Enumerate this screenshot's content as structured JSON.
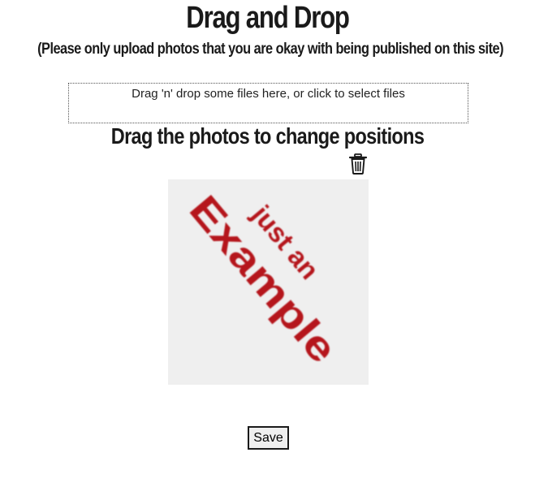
{
  "header": {
    "title": "Drag and Drop",
    "subtitle": "(Please only upload photos that you are okay with being published on this site)"
  },
  "dropzone": {
    "text": "Drag 'n' drop some files here, or click to select files"
  },
  "gallery": {
    "heading": "Drag the photos to change positions",
    "delete_icon": "trash-icon",
    "photos": [
      {
        "line1": "just an",
        "line2": "Example",
        "text_color": "#b5121b",
        "background": "#efefef"
      }
    ]
  },
  "actions": {
    "save_label": "Save"
  }
}
